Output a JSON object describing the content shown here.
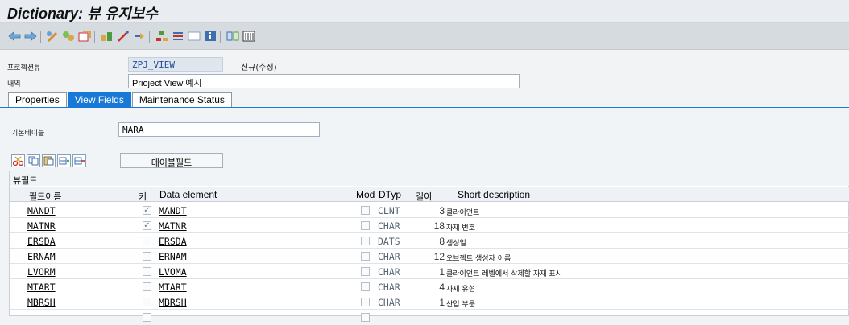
{
  "title": "Dictionary: 뷰 유지보수",
  "toolbar": {
    "icons": [
      "back-arrow",
      "forward-arrow",
      "other-object",
      "display-change",
      "activate",
      "check",
      "where-used",
      "display-object-list",
      "hierarchy",
      "info",
      "documentation",
      "table-view",
      "calendar-grid"
    ]
  },
  "header": {
    "projection_label": "프로젝션뷰",
    "projection_value": "ZPJ_VIEW",
    "status": "신규(수정)",
    "desc_label": "내역",
    "desc_value": "Prioject View 예시"
  },
  "tabs": [
    "Properties",
    "View Fields",
    "Maintenance Status"
  ],
  "basetable": {
    "label": "기본테이블",
    "value": "MARA"
  },
  "tablefields_label": "테이블필드",
  "grid": {
    "title": "뷰필드",
    "columns": {
      "field": "필드이름",
      "key": "키",
      "elem": "Data element",
      "mod": "Mod",
      "dtyp": "DTyp",
      "len": "길이",
      "desc": "Short description"
    },
    "rows": [
      {
        "field": "MANDT",
        "key": true,
        "elem": "MANDT",
        "dtyp": "CLNT",
        "len": "3",
        "desc": "클라이언트"
      },
      {
        "field": "MATNR",
        "key": true,
        "elem": "MATNR",
        "dtyp": "CHAR",
        "len": "18",
        "desc": "자재 번호"
      },
      {
        "field": "ERSDA",
        "key": false,
        "elem": "ERSDA",
        "dtyp": "DATS",
        "len": "8",
        "desc": "생성일"
      },
      {
        "field": "ERNAM",
        "key": false,
        "elem": "ERNAM",
        "dtyp": "CHAR",
        "len": "12",
        "desc": "오브젝트 생성자 이름"
      },
      {
        "field": "LVORM",
        "key": false,
        "elem": "LVOMA",
        "dtyp": "CHAR",
        "len": "1",
        "desc": "클라이언트 레벨에서 삭제할 자재 표시"
      },
      {
        "field": "MTART",
        "key": false,
        "elem": "MTART",
        "dtyp": "CHAR",
        "len": "4",
        "desc": "자재 유형"
      },
      {
        "field": "MBRSH",
        "key": false,
        "elem": "MBRSH",
        "dtyp": "CHAR",
        "len": "1",
        "desc": "산업 부문"
      }
    ]
  }
}
